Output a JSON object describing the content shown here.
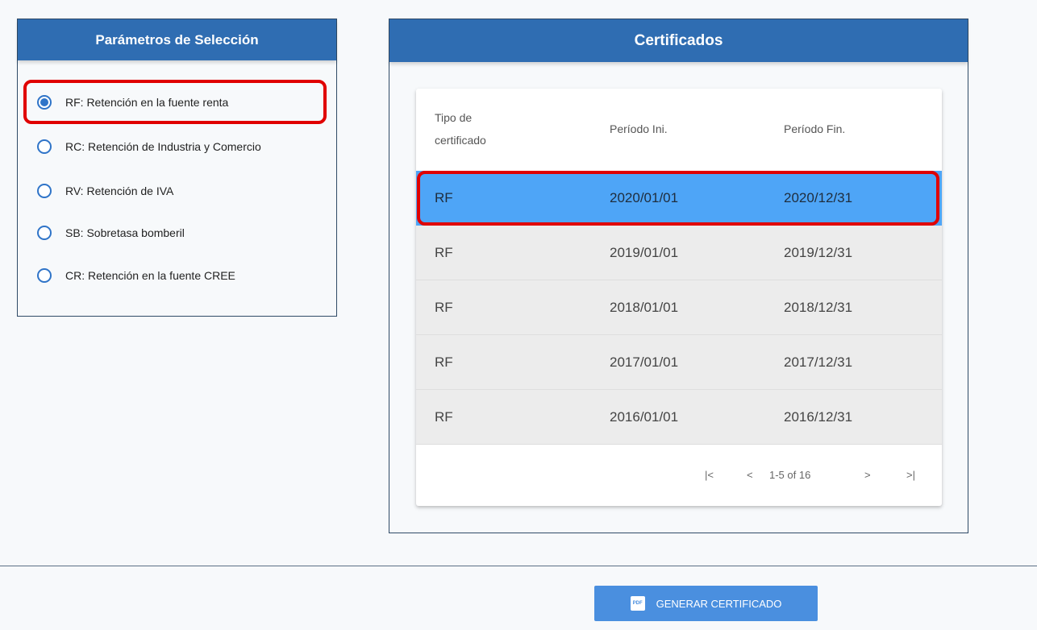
{
  "left_panel": {
    "title": "Parámetros de Selección",
    "options": [
      {
        "label": "RF: Retención en la fuente renta",
        "selected": true
      },
      {
        "label": "RC: Retención de Industria y Comercio",
        "selected": false
      },
      {
        "label": "RV: Retención de IVA",
        "selected": false
      },
      {
        "label": "SB: Sobretasa bomberil",
        "selected": false
      },
      {
        "label": "CR: Retención en la fuente CREE",
        "selected": false
      }
    ]
  },
  "right_panel": {
    "title": "Certificados",
    "table": {
      "headers": {
        "tipo_line1": "Tipo de",
        "tipo_line2": "certificado",
        "inicio": "Período Ini.",
        "fin": "Período Fin."
      },
      "rows": [
        {
          "tipo": "RF",
          "inicio": "2020/01/01",
          "fin": "2020/12/31"
        },
        {
          "tipo": "RF",
          "inicio": "2019/01/01",
          "fin": "2019/12/31"
        },
        {
          "tipo": "RF",
          "inicio": "2018/01/01",
          "fin": "2018/12/31"
        },
        {
          "tipo": "RF",
          "inicio": "2017/01/01",
          "fin": "2017/12/31"
        },
        {
          "tipo": "RF",
          "inicio": "2016/01/01",
          "fin": "2016/12/31"
        }
      ]
    },
    "paginator": {
      "first": "|<",
      "prev": "<",
      "range": "1-5 of 16",
      "next": ">",
      "last": ">|"
    }
  },
  "generate_button": {
    "label": "GENERAR CERTIFICADO",
    "icon_text": "PDF"
  },
  "colors": {
    "header_blue": "#2f6db2",
    "selected_row": "#4ea5f7",
    "highlight": "#e00000",
    "button": "#4a8fdf"
  }
}
